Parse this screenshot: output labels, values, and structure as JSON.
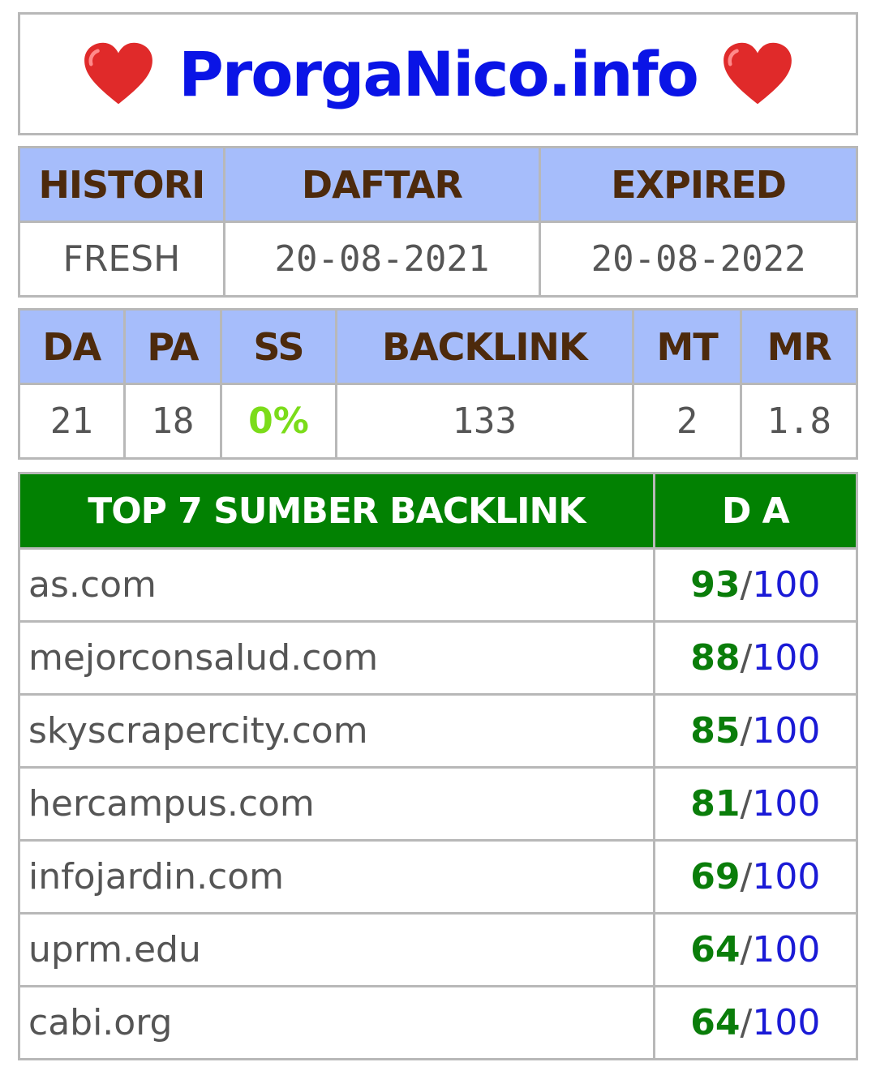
{
  "header": {
    "site_name": "ProrgaNico.info",
    "left_icon": "heart-icon",
    "right_icon": "heart-icon",
    "heart_color": "#e02a2a"
  },
  "registration": {
    "columns": [
      "HISTORI",
      "DAFTAR",
      "EXPIRED"
    ],
    "values": [
      "FRESH",
      "20-08-2021",
      "20-08-2022"
    ]
  },
  "metrics": {
    "columns": [
      "DA",
      "PA",
      "SS",
      "BACKLINK",
      "MT",
      "MR"
    ],
    "values": [
      "21",
      "18",
      "0%",
      "133",
      "2",
      "1.8"
    ]
  },
  "top_backlinks": {
    "title": "TOP 7 SUMBER BACKLINK",
    "da_header": "D A",
    "separator": "/",
    "max": "100",
    "rows": [
      {
        "domain": "as.com",
        "da": "93"
      },
      {
        "domain": "mejorconsalud.com",
        "da": "88"
      },
      {
        "domain": "skyscrapercity.com",
        "da": "85"
      },
      {
        "domain": "hercampus.com",
        "da": "81"
      },
      {
        "domain": "infojardin.com",
        "da": "69"
      },
      {
        "domain": "uprm.edu",
        "da": "64"
      },
      {
        "domain": "cabi.org",
        "da": "64"
      }
    ]
  },
  "colors": {
    "header_bg": "#a6bdfb",
    "header_text": "#4d2a0c",
    "green_header": "#028102",
    "site_name": "#0a14e6",
    "ss_value": "#7bdc19"
  }
}
